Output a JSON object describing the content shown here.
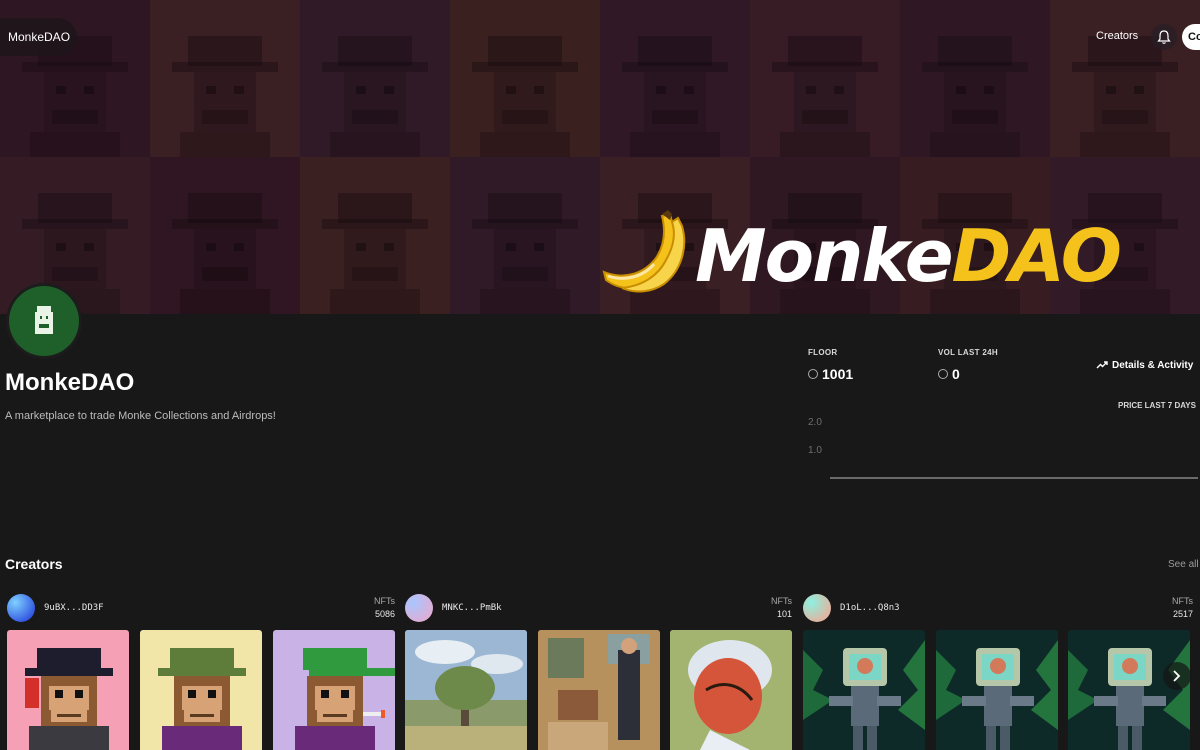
{
  "nav": {
    "brand": "MonkeDAO",
    "links": [
      "Creators"
    ],
    "connect_label": "Co"
  },
  "banner": {
    "logo_word_1": "Monke",
    "logo_word_2": "DAO",
    "logo_colors": {
      "monke": "#ffffff",
      "dao": "#f5c21b"
    },
    "tile_colors": [
      "#3a1d2a",
      "#4a2a2a",
      "#3d2330",
      "#4b2c24",
      "#3b2030",
      "#45262e",
      "#3a1f2c",
      "#4a2b2a",
      "#42262c",
      "#3a1c28",
      "#4a2b26",
      "#3d2230",
      "#4a2a2c",
      "#3b1f2a",
      "#452729",
      "#3e2230"
    ]
  },
  "collection": {
    "name": "MonkeDAO",
    "description": "A marketplace to trade Monke Collections and Airdrops!",
    "avatar_icon": "monke-icon",
    "accent": "#1f5f2a"
  },
  "stats": {
    "floor_label": "FLOOR",
    "floor_value": "1001",
    "vol_label": "VOL LAST 24H",
    "vol_value": "0",
    "details_label": "Details & Activity",
    "currency_icon": "sol-icon"
  },
  "chart_data": {
    "type": "line",
    "title": "PRICE LAST 7 DAYS",
    "y_ticks": [
      "2.0",
      "1.0"
    ],
    "ylim": [
      0,
      2.0
    ],
    "series": [
      {
        "values": []
      }
    ],
    "grid": false
  },
  "creators_section": {
    "title": "Creators",
    "see_all": "See all",
    "creators": [
      {
        "address": "9uBX...DD3F",
        "nfts_label": "NFTs",
        "nfts": "5086",
        "gradient": [
          "#1a2fd8",
          "#7fd0ff"
        ]
      },
      {
        "address": "MNKC...PmBk",
        "nfts_label": "NFTs",
        "nfts": "101",
        "gradient": [
          "#f1a6c8",
          "#a8c6ff"
        ]
      },
      {
        "address": "D1oL...Q8n3",
        "nfts_label": "NFTs",
        "nfts": "2517",
        "gradient": [
          "#ff9f8a",
          "#8ef0e0"
        ]
      }
    ]
  },
  "thumbnails": [
    {
      "name": "pixel-monke-black-hat",
      "bg": "#f5a0b4"
    },
    {
      "name": "pixel-monke-camo-hat",
      "bg": "#f1e5a8"
    },
    {
      "name": "pixel-monke-green-cap",
      "bg": "#c9b2e6"
    },
    {
      "name": "painting-tree-landscape",
      "bg": "#8aa9c9"
    },
    {
      "name": "painting-figures",
      "bg": "#a7825a"
    },
    {
      "name": "painting-portrait",
      "bg": "#9bb16a"
    },
    {
      "name": "jungle-robot-1",
      "bg": "#10302e"
    },
    {
      "name": "jungle-robot-2",
      "bg": "#10302e"
    },
    {
      "name": "jungle-robot-3",
      "bg": "#10302e"
    }
  ]
}
